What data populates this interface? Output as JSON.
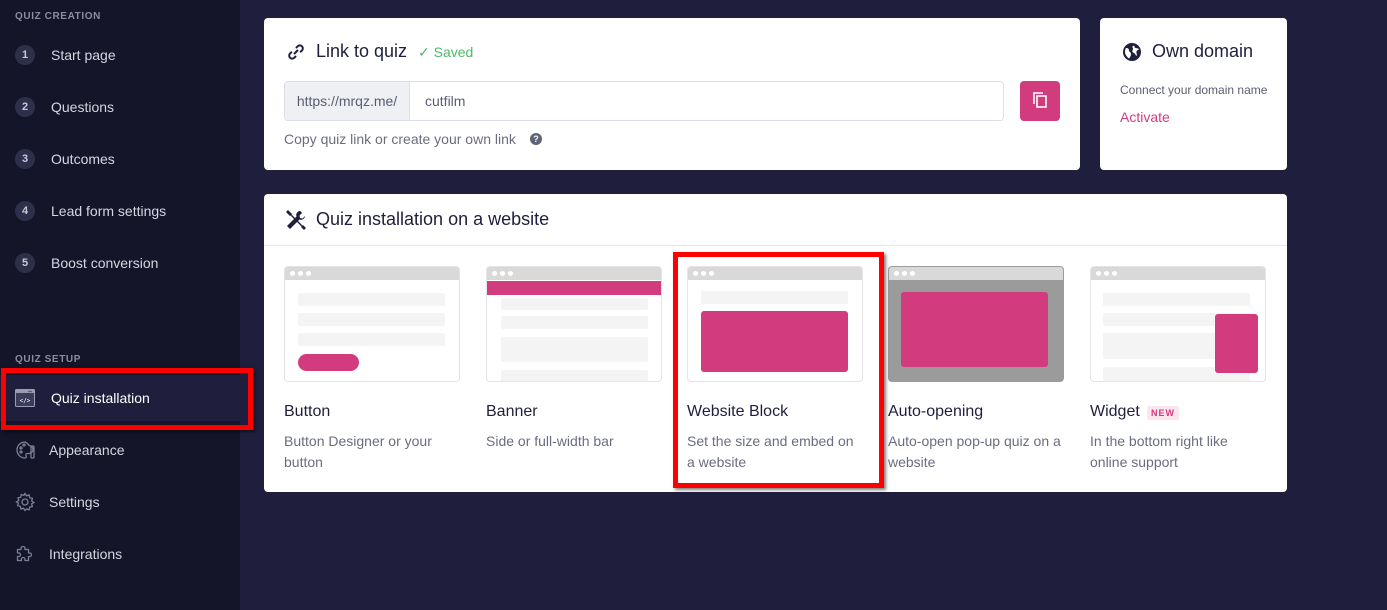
{
  "sidebar": {
    "creation_label": "QUIZ CREATION",
    "steps": [
      {
        "num": "1",
        "label": "Start page"
      },
      {
        "num": "2",
        "label": "Questions"
      },
      {
        "num": "3",
        "label": "Outcomes"
      },
      {
        "num": "4",
        "label": "Lead form settings"
      },
      {
        "num": "5",
        "label": "Boost conversion"
      }
    ],
    "setup_label": "QUIZ SETUP",
    "setup_items": [
      {
        "label": "Quiz installation",
        "icon": "code-window-icon",
        "active": true
      },
      {
        "label": "Appearance",
        "icon": "palette-icon"
      },
      {
        "label": "Settings",
        "icon": "gear-icon"
      },
      {
        "label": "Integrations",
        "icon": "puzzle-icon"
      }
    ]
  },
  "link_card": {
    "title": "Link to quiz",
    "status": "✓ Saved",
    "url_prefix": "https://mrqz.me/",
    "url_value": "cutfilm",
    "hint": "Copy quiz link or create your own link",
    "help": "?"
  },
  "domain_card": {
    "title": "Own domain",
    "description": "Connect your domain name",
    "action": "Activate"
  },
  "install_card": {
    "title": "Quiz installation on a website",
    "options": [
      {
        "title": "Button",
        "description": "Button Designer or your button"
      },
      {
        "title": "Banner",
        "description": "Side or full-width bar"
      },
      {
        "title": "Website Block",
        "description": "Set the size and embed on a website",
        "highlighted": true
      },
      {
        "title": "Auto-opening",
        "description": "Auto-open pop-up quiz on a website"
      },
      {
        "title": "Widget",
        "description": "In the bottom right like online support",
        "badge": "NEW"
      }
    ]
  },
  "colors": {
    "accent": "#d23b7e",
    "saved_green": "#4fb86c",
    "sidebar_bg": "#141529",
    "main_bg": "#1f1f3d",
    "highlight": "#ff0000"
  }
}
